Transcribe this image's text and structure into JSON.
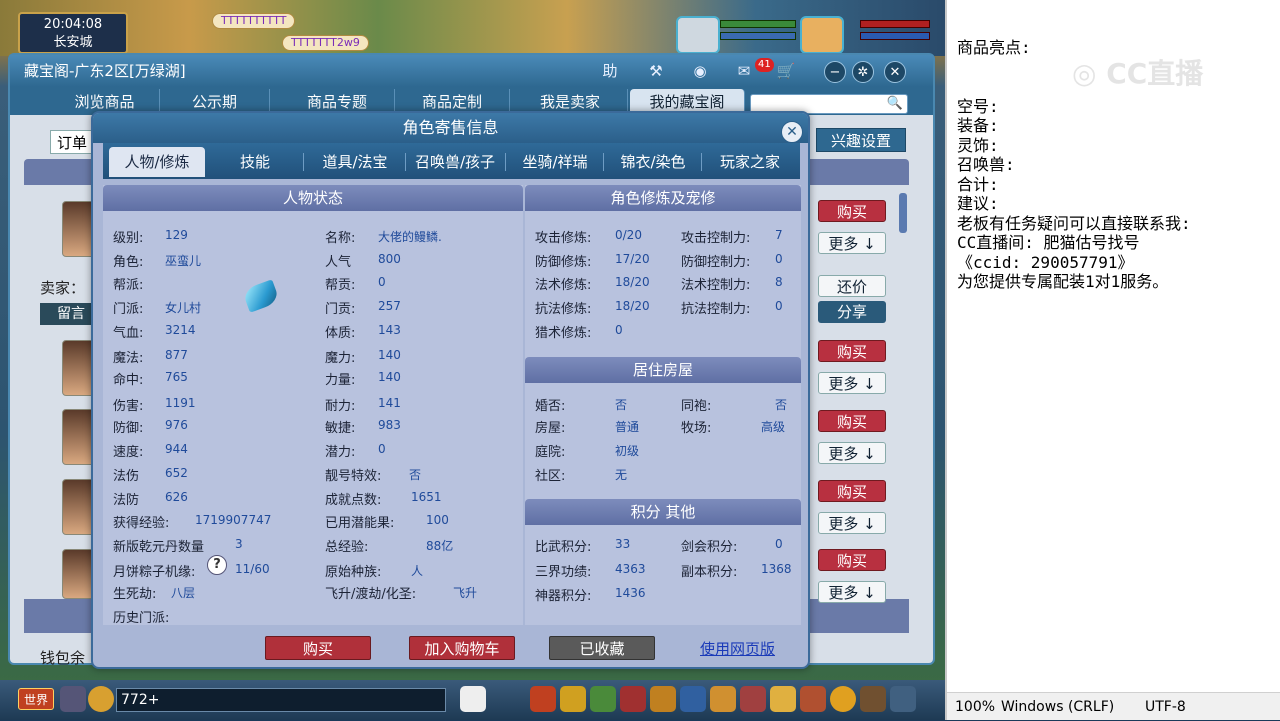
{
  "game": {
    "clock": "20:04:08",
    "location": "长安城",
    "chat_names": [
      "TTTTTTTTTT",
      "TTTTTTT2w9"
    ],
    "world_label": "世界",
    "chat_input_value": "772+"
  },
  "cbg": {
    "title": "藏宝阁-广东2区[万绿湖]",
    "title_icons": [
      "助"
    ],
    "cart_badge": "41",
    "tabs": [
      "浏览商品",
      "公示期",
      "商品专题",
      "商品定制",
      "我是卖家",
      "我的藏宝阁"
    ],
    "order_label": "订单",
    "interest_label": "兴趣设置",
    "seller_label": "卖家：",
    "leave_label": "留言",
    "wallet_label": "钱包余",
    "buy_label": "购买",
    "more_label": "更多",
    "bargain_label": "还价",
    "share_label": "分享"
  },
  "modal": {
    "title": "角色寄售信息",
    "tabs": [
      "人物/修炼",
      "技能",
      "道具/法宝",
      "召唤兽/孩子",
      "坐骑/祥瑞",
      "锦衣/染色",
      "玩家之家"
    ],
    "sections": {
      "status": "人物状态",
      "cultivation": "角色修炼及宠修",
      "house": "居住房屋",
      "points": "积分 其他"
    },
    "status_left": [
      {
        "label": "级别:",
        "value": "129"
      },
      {
        "label": "角色:",
        "value": "巫蛮儿"
      },
      {
        "label": "帮派:",
        "value": ""
      },
      {
        "label": "门派:",
        "value": "女儿村"
      },
      {
        "label": "气血:",
        "value": "3214"
      },
      {
        "label": "魔法:",
        "value": "877"
      },
      {
        "label": "命中:",
        "value": "765"
      },
      {
        "label": "伤害:",
        "value": "1191"
      },
      {
        "label": "防御:",
        "value": "976"
      },
      {
        "label": "速度:",
        "value": "944"
      },
      {
        "label": "法伤",
        "value": "652"
      },
      {
        "label": "法防",
        "value": "626"
      },
      {
        "label": "获得经验:",
        "value": "1719907747"
      },
      {
        "label": "新版乾元丹数量",
        "value": "3"
      },
      {
        "label": "月饼粽子机缘:",
        "value": "11/60"
      },
      {
        "label": "生死劫:",
        "value": "八层"
      },
      {
        "label": "历史门派:",
        "value": ""
      }
    ],
    "status_right": [
      {
        "label": "名称:",
        "value": "大佬的鳗鳞."
      },
      {
        "label": "人气",
        "value": "800"
      },
      {
        "label": "帮贡:",
        "value": "0"
      },
      {
        "label": "门贡:",
        "value": "257"
      },
      {
        "label": "体质:",
        "value": "143"
      },
      {
        "label": "魔力:",
        "value": "140"
      },
      {
        "label": "力量:",
        "value": "140"
      },
      {
        "label": "耐力:",
        "value": "141"
      },
      {
        "label": "敏捷:",
        "value": "983"
      },
      {
        "label": "潜力:",
        "value": "0"
      },
      {
        "label": "靓号特效:",
        "value": "否"
      },
      {
        "label": "成就点数:",
        "value": "1651"
      },
      {
        "label": "已用潜能果:",
        "value": "100"
      },
      {
        "label": "总经验:",
        "value": "88亿"
      },
      {
        "label": "原始种族:",
        "value": "人"
      },
      {
        "label": "飞升/渡劫/化圣:",
        "value": "飞升"
      }
    ],
    "cultivation": [
      {
        "label": "攻击修炼:",
        "value": "0/20",
        "label2": "攻击控制力:",
        "value2": "7"
      },
      {
        "label": "防御修炼:",
        "value": "17/20",
        "label2": "防御控制力:",
        "value2": "0"
      },
      {
        "label": "法术修炼:",
        "value": "18/20",
        "label2": "法术控制力:",
        "value2": "8"
      },
      {
        "label": "抗法修炼:",
        "value": "18/20",
        "label2": "抗法控制力:",
        "value2": "0"
      },
      {
        "label": "猎术修炼:",
        "value": "0",
        "label2": "",
        "value2": ""
      }
    ],
    "house": [
      {
        "label": "婚否:",
        "value": "否",
        "label2": "同袍:",
        "value2": "否"
      },
      {
        "label": "房屋:",
        "value": "普通",
        "label2": "牧场:",
        "value2": "高级"
      },
      {
        "label": "庭院:",
        "value": "初级",
        "label2": "",
        "value2": ""
      },
      {
        "label": "社区:",
        "value": "无",
        "label2": "",
        "value2": ""
      }
    ],
    "points": [
      {
        "label": "比武积分:",
        "value": "33",
        "label2": "剑会积分:",
        "value2": "0"
      },
      {
        "label": "三界功绩:",
        "value": "4363",
        "label2": "副本积分:",
        "value2": "1368"
      },
      {
        "label": "神器积分:",
        "value": "1436",
        "label2": "",
        "value2": ""
      }
    ],
    "buttons": {
      "buy": "购买",
      "add_cart": "加入购物车",
      "collected": "已收藏",
      "web_version": "使用网页版"
    }
  },
  "notepad": {
    "lines": [
      "商品亮点:",
      "",
      "",
      "空号:",
      "装备:",
      "灵饰:",
      "召唤兽:",
      "合计:",
      "建议:",
      "老板有任务疑问可以直接联系我:",
      "CC直播间: 肥猫估号找号",
      "《ccid: 290057791》",
      "为您提供专属配装1对1服务。"
    ],
    "watermark": "CC直播",
    "status": {
      "zoom": "100%",
      "line_ending": "Windows (CRLF)",
      "encoding": "UTF-8"
    }
  }
}
